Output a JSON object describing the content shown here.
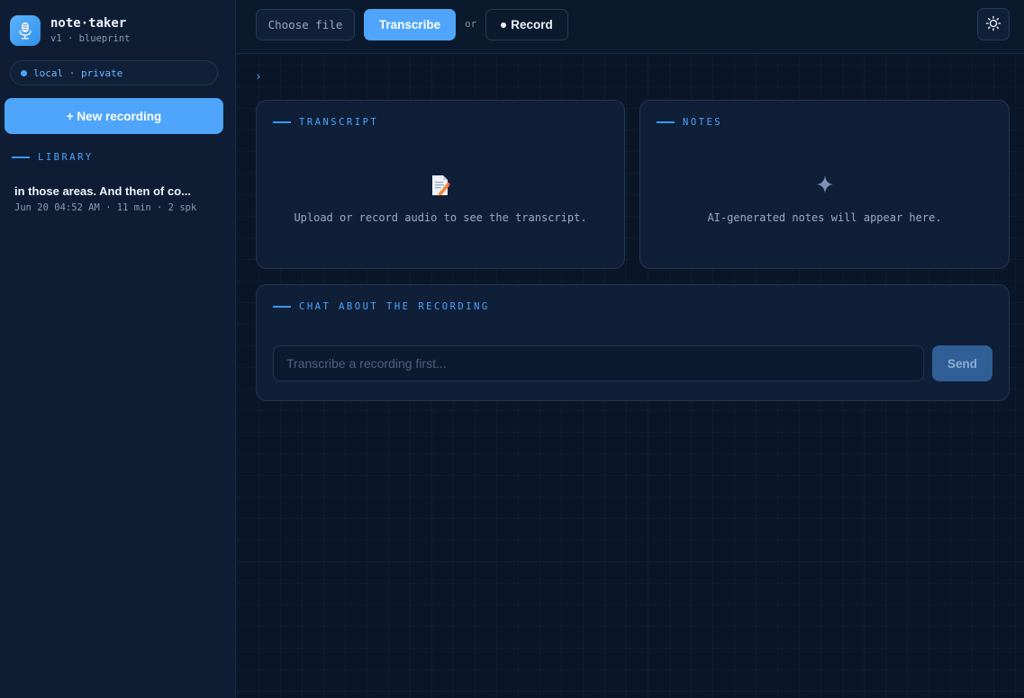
{
  "app": {
    "name": "note·taker",
    "subtitle": "v1 · blueprint",
    "logo_icon": "microphone-icon"
  },
  "sidebar": {
    "status": "local · private",
    "new_button": "+ New recording",
    "library_label": "LIBRARY",
    "library_items": [
      {
        "title": "in those areas. And then of co...",
        "meta": "Jun 20 04:52 AM · 11 min · 2 spk"
      }
    ]
  },
  "toolbar": {
    "choose_file": "Choose file",
    "transcribe": "Transcribe",
    "or": "or",
    "record": "Record",
    "theme_icon": "sun-icon"
  },
  "panels": {
    "chevron": "›",
    "transcript": {
      "label": "TRANSCRIPT",
      "empty_text": "Upload or record audio to see the transcript.",
      "icon": "memo-icon"
    },
    "notes": {
      "label": "NOTES",
      "empty_text": "AI-generated notes will appear here.",
      "icon": "sparkle-icon"
    },
    "chat": {
      "label": "CHAT ABOUT THE RECORDING",
      "placeholder": "Transcribe a recording first...",
      "send": "Send"
    }
  },
  "colors": {
    "accent": "#4ea5fb",
    "background": "#0a1628",
    "sidebar": "#0e1d33",
    "card": "#0f1f37"
  }
}
